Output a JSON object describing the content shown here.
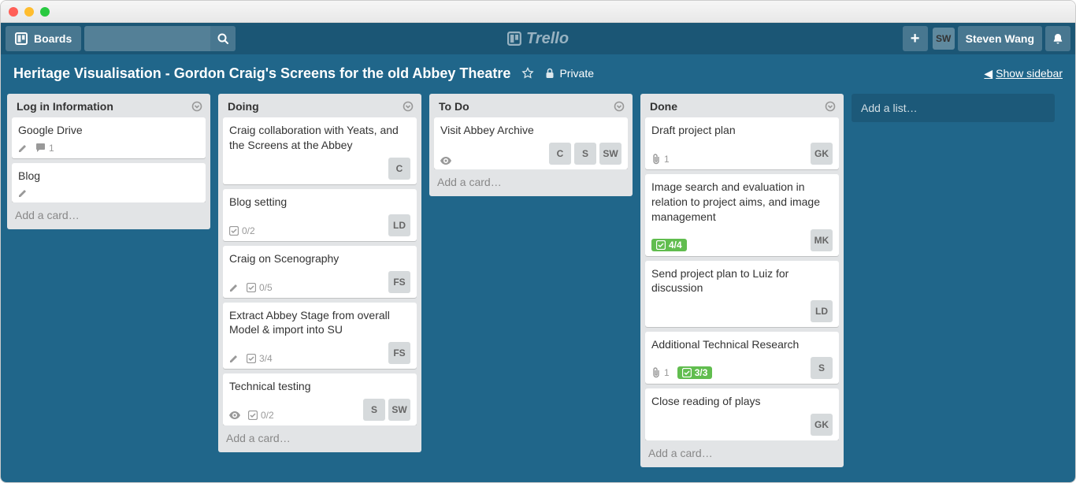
{
  "header": {
    "boards_label": "Boards",
    "search_placeholder": "",
    "logo_text": "Trello",
    "user_initials": "SW",
    "user_name": "Steven Wang"
  },
  "board": {
    "title": "Heritage Visualisation - Gordon Craig's Screens for the old Abbey Theatre",
    "privacy": "Private",
    "show_sidebar": "Show sidebar"
  },
  "ui": {
    "add_card": "Add a card…",
    "add_list": "Add a list…"
  },
  "lists": [
    {
      "name": "Log in Information",
      "cards": [
        {
          "title": "Google Drive",
          "badges": {
            "desc": true,
            "comments": 1
          }
        },
        {
          "title": "Blog",
          "badges": {
            "desc": true
          }
        }
      ]
    },
    {
      "name": "Doing",
      "cards": [
        {
          "title": "Craig collaboration with Yeats, and the Screens at the Abbey",
          "members": [
            "C"
          ]
        },
        {
          "title": "Blog setting",
          "badges": {
            "checklist": "0/2"
          },
          "members": [
            "LD"
          ]
        },
        {
          "title": "Craig on Scenography",
          "badges": {
            "desc": true,
            "checklist": "0/5"
          },
          "members": [
            "FS"
          ]
        },
        {
          "title": "Extract Abbey Stage from overall Model & import into SU",
          "badges": {
            "desc": true,
            "checklist": "3/4"
          },
          "members": [
            "FS"
          ]
        },
        {
          "title": "Technical testing",
          "badges": {
            "subscribed": true,
            "checklist": "0/2"
          },
          "members": [
            "S",
            "SW"
          ]
        }
      ]
    },
    {
      "name": "To Do",
      "cards": [
        {
          "title": "Visit Abbey Archive",
          "badges": {
            "subscribed": true
          },
          "members": [
            "C",
            "S",
            "SW"
          ]
        }
      ]
    },
    {
      "name": "Done",
      "scroll": true,
      "cards": [
        {
          "title": "Draft project plan",
          "badges": {
            "attachment": 1
          },
          "members": [
            "GK"
          ]
        },
        {
          "title": "Image search and evaluation in relation to project aims, and image management",
          "badges": {
            "checklist": "4/4",
            "checklist_complete": true
          },
          "members": [
            "MK"
          ]
        },
        {
          "title": "Send project plan to Luiz for discussion",
          "members": [
            "LD"
          ]
        },
        {
          "title": "Additional Technical Research",
          "badges": {
            "attachment": 1,
            "checklist": "3/3",
            "checklist_complete": true
          },
          "members": [
            "S"
          ]
        },
        {
          "title": "Close reading of plays",
          "members": [
            "GK"
          ]
        }
      ]
    }
  ]
}
